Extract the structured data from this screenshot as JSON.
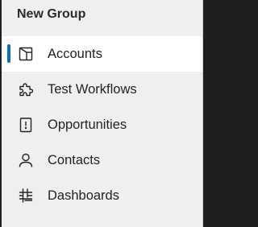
{
  "group": {
    "title": "New Group"
  },
  "nav": {
    "items": [
      {
        "label": "Accounts",
        "icon": "account-icon",
        "selected": true
      },
      {
        "label": "Test Workflows",
        "icon": "puzzle-icon",
        "selected": false
      },
      {
        "label": "Opportunities",
        "icon": "opportunity-icon",
        "selected": false
      },
      {
        "label": "Contacts",
        "icon": "person-icon",
        "selected": false
      },
      {
        "label": "Dashboards",
        "icon": "dashboard-icon",
        "selected": false
      }
    ]
  },
  "colors": {
    "accent": "#0f6cbd",
    "panel_bg": "#efefef",
    "selected_bg": "#ffffff",
    "text": "#242424"
  }
}
